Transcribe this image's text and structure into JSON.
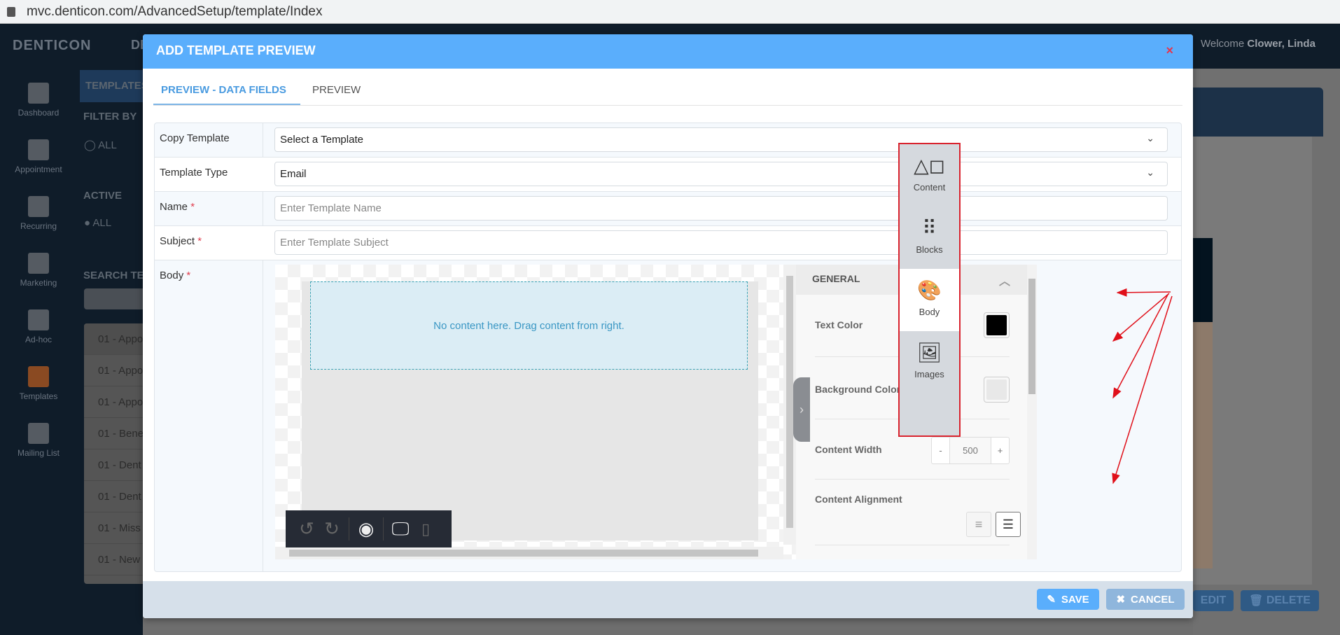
{
  "browser": {
    "url": "mvc.denticon.com/AdvancedSetup/template/Index"
  },
  "app": {
    "logo": "DENTICON",
    "welcome_prefix": "Welcome",
    "user_name": "Clower, Linda",
    "partial_nav": "DE"
  },
  "sidebar": {
    "items": [
      {
        "label": "Dashboard",
        "icon": "dashboard-icon"
      },
      {
        "label": "Appointment",
        "icon": "appointment-icon"
      },
      {
        "label": "Recurring",
        "icon": "recurring-icon"
      },
      {
        "label": "Marketing",
        "icon": "marketing-icon"
      },
      {
        "label": "Ad-hoc",
        "icon": "adhoc-icon"
      },
      {
        "label": "Templates",
        "icon": "templates-icon"
      },
      {
        "label": "Mailing List",
        "icon": "mailing-list-icon"
      }
    ]
  },
  "left_panel": {
    "title": "TEMPLATES",
    "filter_by": "FILTER BY",
    "filter_all": "ALL",
    "active": "ACTIVE",
    "active_all": "ALL",
    "search": "SEARCH TE",
    "list": [
      "01 - Appo",
      "01 - Appo",
      "01 - Appo",
      "01 - Bene",
      "01 - Dent",
      "01 - Dent",
      "01 - Miss",
      "01 - New"
    ]
  },
  "background_buttons": {
    "edit": "EDIT",
    "delete": "DELETE"
  },
  "modal": {
    "title": "ADD TEMPLATE PREVIEW",
    "close": "×",
    "tabs": [
      {
        "label": "PREVIEW - DATA FIELDS",
        "active": true
      },
      {
        "label": "PREVIEW",
        "active": false
      }
    ],
    "fields": {
      "copy_template": {
        "label": "Copy Template",
        "value": "Select a Template"
      },
      "template_type": {
        "label": "Template Type",
        "value": "Email"
      },
      "name": {
        "label": "Name",
        "required": "*",
        "placeholder": "Enter Template Name"
      },
      "subject": {
        "label": "Subject",
        "required": "*",
        "placeholder": "Enter Template Subject"
      },
      "body": {
        "label": "Body",
        "required": "*"
      }
    },
    "editor": {
      "dropzone_text": "No content here. Drag content from right.",
      "settings": {
        "section": "GENERAL",
        "text_color_label": "Text Color",
        "text_color": "#000000",
        "background_color_label": "Background Color",
        "background_color": "#e8e8e8",
        "content_width_label": "Content Width",
        "content_width": "500",
        "minus": "-",
        "plus": "+",
        "content_alignment_label": "Content Alignment",
        "content_alignment": "center"
      },
      "side_tabs": [
        {
          "label": "Content",
          "icon": "shapes-icon"
        },
        {
          "label": "Blocks",
          "icon": "grid-icon"
        },
        {
          "label": "Body",
          "icon": "palette-icon",
          "active": true
        },
        {
          "label": "Images",
          "icon": "images-icon"
        }
      ]
    },
    "footer": {
      "save": "SAVE",
      "cancel": "CANCEL"
    }
  },
  "colors": {
    "header": "#5aaefc",
    "save": "#5aaefc",
    "cancel": "#8fb6dc",
    "annotation": "#d9232e"
  }
}
